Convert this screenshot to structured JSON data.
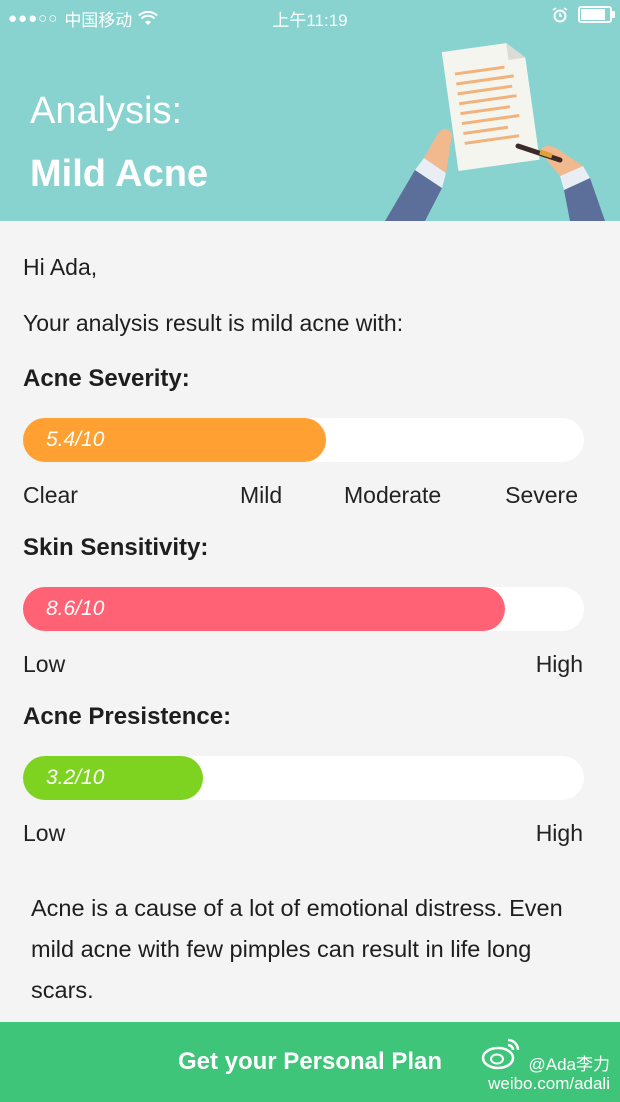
{
  "status_bar": {
    "signal": "●●●○○",
    "carrier": "中国移动",
    "time": "上午11:19"
  },
  "header": {
    "title": "Analysis:",
    "subtitle": "Mild Acne"
  },
  "body": {
    "greeting": "Hi Ada,",
    "intro": "Your analysis result is mild acne with:"
  },
  "metrics": [
    {
      "title": "Acne Severity:",
      "value_label": "5.4/10",
      "value": 5.4,
      "max": 10,
      "color": "#ffa033",
      "scale": [
        "Clear",
        "Mild",
        "Moderate",
        "Severe"
      ]
    },
    {
      "title": "Skin Sensitivity:",
      "value_label": "8.6/10",
      "value": 8.6,
      "max": 10,
      "color": "#ff6274",
      "scale": [
        "Low",
        "High"
      ]
    },
    {
      "title": "Acne Presistence:",
      "value_label": "3.2/10",
      "value": 3.2,
      "max": 10,
      "color": "#7ed321",
      "scale": [
        "Low",
        "High"
      ]
    }
  ],
  "note": "Acne is a cause of a lot of emotional distress. Even mild acne with few pimples can result in life long scars.",
  "cta": {
    "label": "Get your Personal Plan",
    "color": "#3fc57a"
  },
  "watermark": {
    "handle": "@Ada李力",
    "url": "weibo.com/adali"
  },
  "colors": {
    "header_bg": "#88d3cf",
    "page_bg": "#f4f4f4"
  }
}
